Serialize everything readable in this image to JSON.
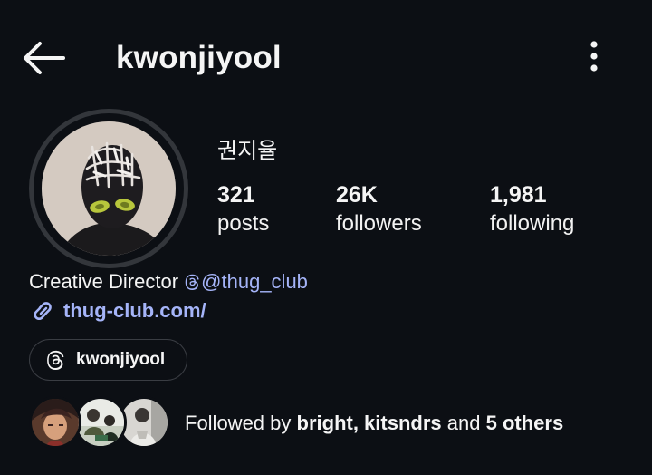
{
  "header": {
    "username": "kwonjiyool"
  },
  "profile": {
    "display_name": "권지율",
    "stats": [
      {
        "value": "321",
        "label": "posts"
      },
      {
        "value": "26K",
        "label": "followers"
      },
      {
        "value": "1,981",
        "label": "following"
      }
    ],
    "bio": {
      "text": "Creative Director",
      "mention": "@thug_club"
    },
    "link": "thug-club.com/",
    "threads_handle": "kwonjiyool"
  },
  "followed_by": {
    "prefix": "Followed by",
    "names": "bright, kitsndrs",
    "connector": "and",
    "others": "5 others"
  },
  "icons": {
    "back": "arrow-left-icon",
    "more": "kebab-menu-icon",
    "mention": "threads-icon",
    "link": "link-icon",
    "chip": "threads-icon"
  },
  "colors": {
    "background": "#0c0f14",
    "text": "#f5f5f5",
    "link": "#a5b4f8",
    "ring": "#33363b"
  }
}
